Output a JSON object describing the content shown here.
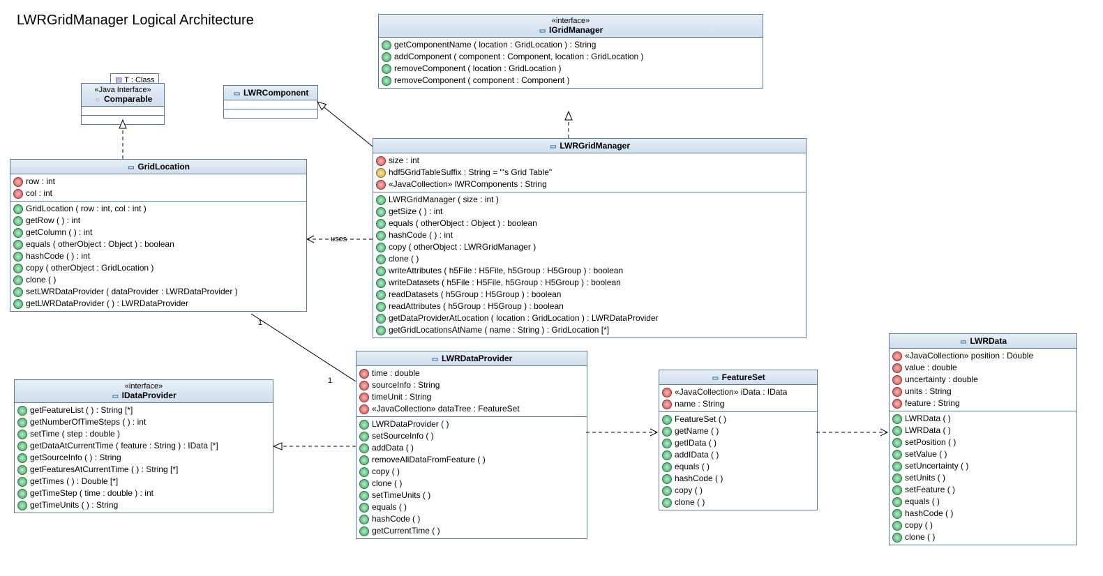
{
  "title": "LWRGridManager Logical Architecture",
  "classes": {
    "comparable": {
      "stereotype": "«Java Interface»",
      "name": "Comparable",
      "param_label": "T : Class"
    },
    "lwrComponent": {
      "name": "LWRComponent"
    },
    "igridManager": {
      "stereotype": "«interface»",
      "name": "IGridManager",
      "ops": [
        "getComponentName ( location : GridLocation ) : String",
        "addComponent ( component : Component, location : GridLocation )",
        "removeComponent ( location : GridLocation )",
        "removeComponent ( component : Component )"
      ]
    },
    "gridLocation": {
      "name": "GridLocation",
      "attrs": [
        {
          "vis": "private",
          "text": "row : int"
        },
        {
          "vis": "private",
          "text": "col : int"
        }
      ],
      "ops": [
        "GridLocation ( row : int, col : int )",
        "getRow ( ) : int",
        "getColumn ( ) : int",
        "equals ( otherObject : Object ) : boolean",
        "hashCode ( ) : int",
        "copy ( otherObject : GridLocation )",
        "clone ( )",
        "setLWRDataProvider ( dataProvider : LWRDataProvider )",
        "getLWRDataProvider ( ) : LWRDataProvider"
      ]
    },
    "lwrGridManager": {
      "name": "LWRGridManager",
      "attrs": [
        {
          "vis": "private",
          "text": "size : int"
        },
        {
          "vis": "protected",
          "text": "hdf5GridTableSuffix : String = \"'s Grid Table\""
        },
        {
          "vis": "private",
          "text": "«JavaCollection» lWRComponents : String"
        }
      ],
      "ops": [
        "LWRGridManager ( size : int )",
        "getSize ( ) : int",
        "equals ( otherObject : Object ) : boolean",
        "hashCode ( ) : int",
        "copy ( otherObject : LWRGridManager )",
        "clone ( )",
        "writeAttributes ( h5File : H5File, h5Group : H5Group ) : boolean",
        "writeDatasets ( h5File : H5File, h5Group : H5Group ) : boolean",
        "readDatasets ( h5Group : H5Group ) : boolean",
        "readAttributes ( h5Group : H5Group ) : boolean",
        "getDataProviderAtLocation ( location : GridLocation ) : LWRDataProvider",
        "getGridLocationsAtName ( name : String ) : GridLocation [*]"
      ]
    },
    "idataProvider": {
      "stereotype": "«interface»",
      "name": "IDataProvider",
      "ops": [
        "getFeatureList ( ) : String [*]",
        "getNumberOfTimeSteps ( ) : int",
        "setTime ( step : double )",
        "getDataAtCurrentTime ( feature : String ) : IData [*]",
        "getSourceInfo ( ) : String",
        "getFeaturesAtCurrentTime ( ) : String [*]",
        "getTimes ( ) : Double [*]",
        "getTimeStep ( time : double ) : int",
        "getTimeUnits ( ) : String"
      ]
    },
    "lwrDataProvider": {
      "name": "LWRDataProvider",
      "attrs": [
        {
          "vis": "private",
          "text": "time : double"
        },
        {
          "vis": "private",
          "text": "sourceInfo : String"
        },
        {
          "vis": "private",
          "text": "timeUnit : String"
        },
        {
          "vis": "private",
          "text": "«JavaCollection» dataTree : FeatureSet"
        }
      ],
      "ops": [
        "LWRDataProvider ( )",
        "setSourceInfo ( )",
        "addData ( )",
        "removeAllDataFromFeature ( )",
        "copy ( )",
        "clone ( )",
        "setTimeUnits ( )",
        "equals ( )",
        "hashCode ( )",
        "getCurrentTime ( )"
      ]
    },
    "featureSet": {
      "name": "FeatureSet",
      "attrs": [
        {
          "vis": "private",
          "text": "«JavaCollection» iData : IData"
        },
        {
          "vis": "private",
          "text": "name : String"
        }
      ],
      "ops": [
        "FeatureSet ( )",
        "getName ( )",
        "getIData ( )",
        "addIData ( )",
        "equals ( )",
        "hashCode ( )",
        "copy ( )",
        "clone ( )"
      ]
    },
    "lwrData": {
      "name": "LWRData",
      "attrs": [
        {
          "vis": "private",
          "text": "«JavaCollection» position : Double"
        },
        {
          "vis": "private",
          "text": "value : double"
        },
        {
          "vis": "private",
          "text": "uncertainty : double"
        },
        {
          "vis": "private",
          "text": "units : String"
        },
        {
          "vis": "private",
          "text": "feature : String"
        }
      ],
      "ops": [
        "LWRData ( )",
        "LWRData ( )",
        "setPosition ( )",
        "setValue ( )",
        "setUncertainty ( )",
        "setUnits ( )",
        "setFeature ( )",
        "equals ( )",
        "hashCode ( )",
        "copy ( )",
        "clone ( )"
      ]
    }
  },
  "edges": {
    "uses_label": "uses",
    "mult_1a": "1",
    "mult_1b": "1"
  }
}
